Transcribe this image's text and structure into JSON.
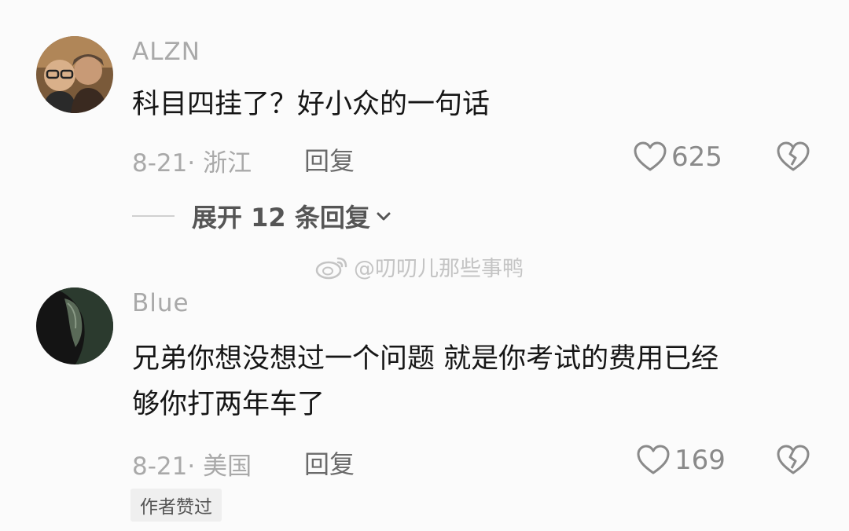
{
  "comments": [
    {
      "username": "ALZN",
      "text_lines": [
        "科目四挂了？好小众的一句话"
      ],
      "date_location": "8-21· 浙江",
      "reply_label": "回复",
      "like_count": "625",
      "expand_label": "展开 12 条回复"
    },
    {
      "username": "Blue",
      "text_lines": [
        "兄弟你想没想过一个问题 就是你考试的费用已经",
        "够你打两年车了"
      ],
      "date_location": "8-21· 美国",
      "reply_label": "回复",
      "like_count": "169",
      "badge": "作者赞过"
    }
  ],
  "watermark": "@叨叨儿那些事鸭",
  "icons": {
    "like": "heart-outline-icon",
    "dislike": "broken-heart-icon",
    "expand": "chevron-down-icon",
    "watermark": "weibo-logo-icon"
  }
}
